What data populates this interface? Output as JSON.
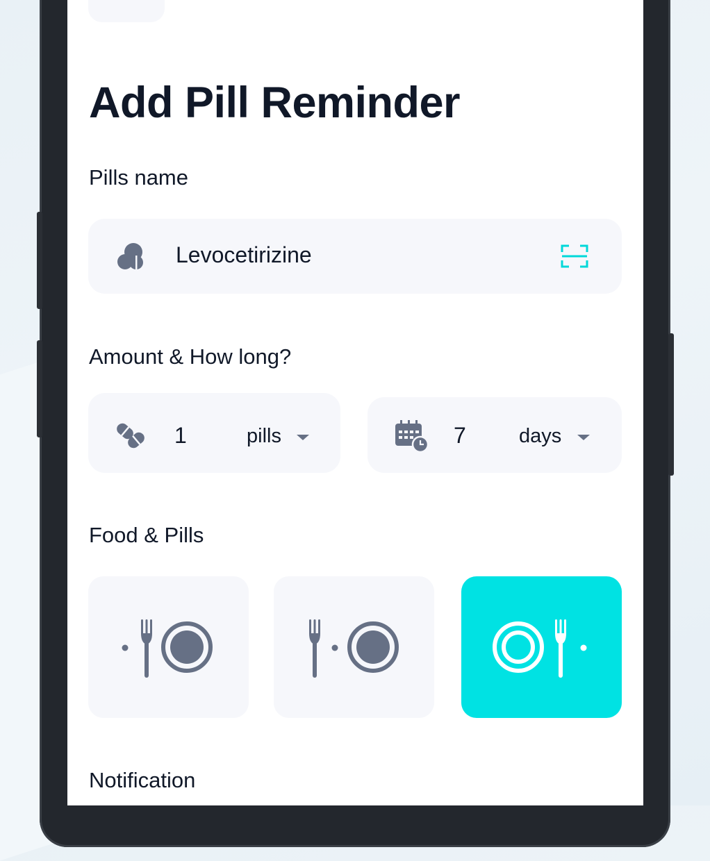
{
  "form": {
    "title": "Add Pill Reminder",
    "pills_name_label": "Pills name",
    "pills_name_value": "Levocetirizine",
    "amount_label": "Amount & How long?",
    "amount_value": "1",
    "amount_unit": "pills",
    "duration_value": "7",
    "duration_unit": "days",
    "food_label": "Food & Pills",
    "food_options": [
      {
        "icon": "before-meal-icon",
        "selected": false
      },
      {
        "icon": "with-meal-icon",
        "selected": false
      },
      {
        "icon": "after-meal-icon",
        "selected": true
      }
    ],
    "notification_label": "Notification"
  },
  "colors": {
    "accent": "#00e2e3",
    "field_bg": "#f6f7fb",
    "icon": "#667085",
    "text": "#101828"
  }
}
